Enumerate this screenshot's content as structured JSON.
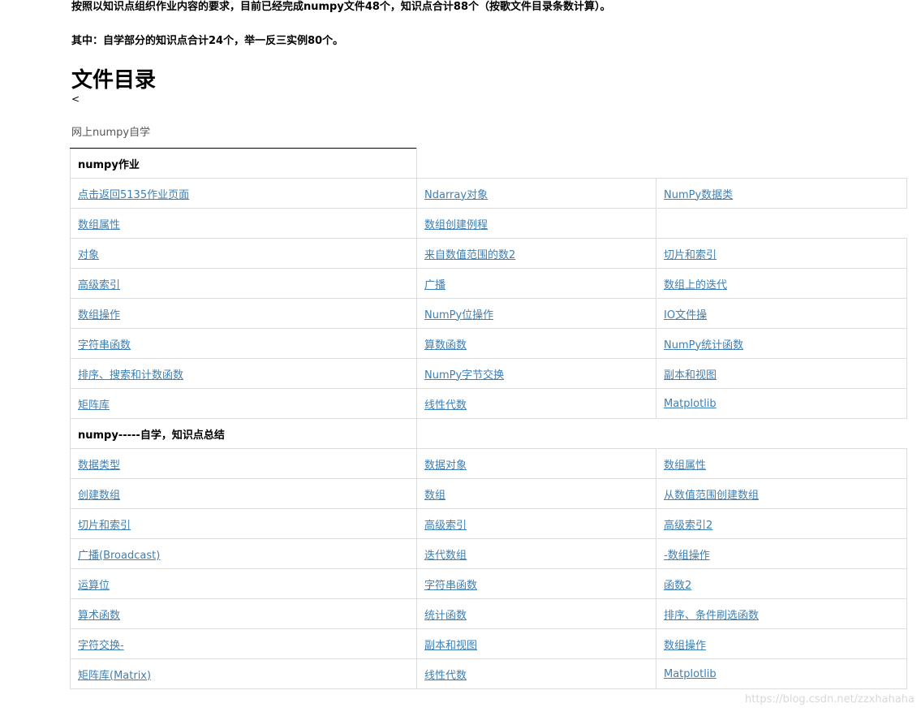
{
  "intro": {
    "line1": "按照以知识点组织作业内容的要求，目前已经完成numpy文件48个，知识点合计88个（按歌文件目录条数计算）。",
    "line2": "其中：自学部分的知识点合计24个，举一反三实例80个。"
  },
  "title": "文件目录",
  "back_glyph": "<",
  "subtitle": "网上numpy自学",
  "sections": [
    {
      "heading": "numpy作业",
      "rows": [
        [
          "点击返回5135作业页面",
          "Ndarray对象",
          "NumPy数据类"
        ],
        [
          "数组属性",
          "数组创建例程",
          ""
        ],
        [
          "对象",
          "来自数值范围的数2",
          "切片和索引"
        ],
        [
          "高级索引",
          "广播",
          "数组上的迭代"
        ],
        [
          "数组操作",
          "NumPy位操作",
          "IO文件操"
        ],
        [
          "字符串函数",
          "算数函数",
          "NumPy统计函数"
        ],
        [
          "排序、搜索和计数函数",
          "NumPy字节交换",
          "副本和视图"
        ],
        [
          "矩阵库",
          "线性代数",
          "Matplotlib"
        ]
      ]
    },
    {
      "heading": "numpy-----自学，知识点总结",
      "rows": [
        [
          "数据类型",
          "数据对象",
          "数组属性"
        ],
        [
          "创建数组",
          "数组",
          "从数值范围创建数组"
        ],
        [
          "切片和索引",
          "高级索引",
          "高级索引2"
        ],
        [
          "广播(Broadcast)",
          "迭代数组",
          "-数组操作"
        ],
        [
          "运算位",
          "字符串函数",
          "函数2"
        ],
        [
          "算术函数",
          "统计函数",
          "排序、条件刷选函数"
        ],
        [
          "字符交换-",
          "副本和视图",
          "数组操作"
        ],
        [
          "矩阵库(Matrix)",
          "线性代数",
          "Matplotlib"
        ]
      ]
    }
  ],
  "watermark": "https://blog.csdn.net/zzxhahaha",
  "colors": {
    "link": "#3f7fb3",
    "border": "#dcdcdc",
    "subtitle": "#555555",
    "watermark": "#d8d8d8"
  }
}
